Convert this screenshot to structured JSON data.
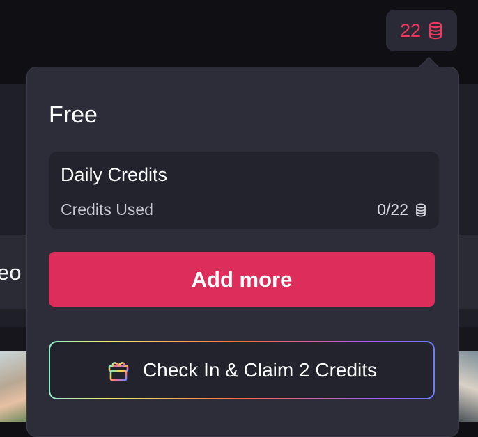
{
  "header": {
    "credit_badge": {
      "value": "22",
      "icon": "coins-stack-icon",
      "color": "#f0385e"
    }
  },
  "background": {
    "card_text_fragment": "eo /"
  },
  "popover": {
    "plan_name": "Free",
    "daily_credits": {
      "title": "Daily Credits",
      "used_label": "Credits Used",
      "used_value": "0/22",
      "icon": "coins-stack-icon"
    },
    "add_more_label": "Add more",
    "add_more_color": "#dc2d5b",
    "check_in": {
      "label": "Check In & Claim 2 Credits",
      "icon": "gift-icon"
    }
  }
}
